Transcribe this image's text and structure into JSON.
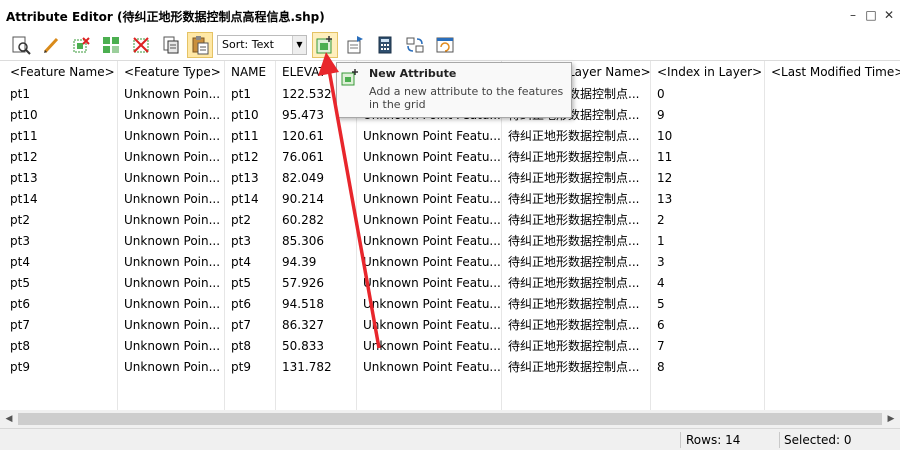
{
  "window": {
    "title": "Attribute Editor (待纠正地形数据控制点高程信息.shp)",
    "minimize": "–",
    "maximize": "□",
    "close": "✕"
  },
  "toolbar": {
    "sort_label": "Sort: Text",
    "icons": [
      "zoom-to-feature-icon",
      "edit-icon",
      "select-features-icon",
      "select-all-icon",
      "clear-selection-icon",
      "copy-icon",
      "paste-icon",
      "new-attribute-icon",
      "export-icon",
      "calculator-icon",
      "swap-icon",
      "refresh-icon"
    ]
  },
  "grid": {
    "columns": [
      "<Feature Name>",
      "<Feature Type>",
      "NAME",
      "ELEVAT",
      "",
      "Layer Name>",
      "<Index in Layer>",
      "<Last Modified Time>"
    ],
    "rows": [
      [
        "pt1",
        "Unknown Poin...",
        "pt1",
        "122.532",
        "Unknown Point Featu...",
        "待纠正地形数据控制点...",
        "0"
      ],
      [
        "pt10",
        "Unknown Poin...",
        "pt10",
        "95.473",
        "Unknown Point Featu...",
        "待纠正地形数据控制点...",
        "9"
      ],
      [
        "pt11",
        "Unknown Poin...",
        "pt11",
        "120.61",
        "Unknown Point Featu...",
        "待纠正地形数据控制点...",
        "10"
      ],
      [
        "pt12",
        "Unknown Poin...",
        "pt12",
        "76.061",
        "Unknown Point Featu...",
        "待纠正地形数据控制点...",
        "11"
      ],
      [
        "pt13",
        "Unknown Poin...",
        "pt13",
        "82.049",
        "Unknown Point Featu...",
        "待纠正地形数据控制点...",
        "12"
      ],
      [
        "pt14",
        "Unknown Poin...",
        "pt14",
        "90.214",
        "Unknown Point Featu...",
        "待纠正地形数据控制点...",
        "13"
      ],
      [
        "pt2",
        "Unknown Poin...",
        "pt2",
        "60.282",
        "Unknown Point Featu...",
        "待纠正地形数据控制点...",
        "2"
      ],
      [
        "pt3",
        "Unknown Poin...",
        "pt3",
        "85.306",
        "Unknown Point Featu...",
        "待纠正地形数据控制点...",
        "1"
      ],
      [
        "pt4",
        "Unknown Poin...",
        "pt4",
        "94.39",
        "Unknown Point Featu...",
        "待纠正地形数据控制点...",
        "3"
      ],
      [
        "pt5",
        "Unknown Poin...",
        "pt5",
        "57.926",
        "Unknown Point Featu...",
        "待纠正地形数据控制点...",
        "4"
      ],
      [
        "pt6",
        "Unknown Poin...",
        "pt6",
        "94.518",
        "Unknown Point Featu...",
        "待纠正地形数据控制点...",
        "5"
      ],
      [
        "pt7",
        "Unknown Poin...",
        "pt7",
        "86.327",
        "Unknown Point Featu...",
        "待纠正地形数据控制点...",
        "6"
      ],
      [
        "pt8",
        "Unknown Poin...",
        "pt8",
        "50.833",
        "Unknown Point Featu...",
        "待纠正地形数据控制点...",
        "7"
      ],
      [
        "pt9",
        "Unknown Poin...",
        "pt9",
        "131.782",
        "Unknown Point Featu...",
        "待纠正地形数据控制点...",
        "8"
      ]
    ]
  },
  "tooltip": {
    "title": "New Attribute",
    "text": "Add a new attribute to the features in the grid"
  },
  "status": {
    "rows": "Rows: 14",
    "selected": "Selected: 0"
  },
  "colors": {
    "annotation_arrow": "#e8262c",
    "active_button": "#ffe8a6"
  }
}
